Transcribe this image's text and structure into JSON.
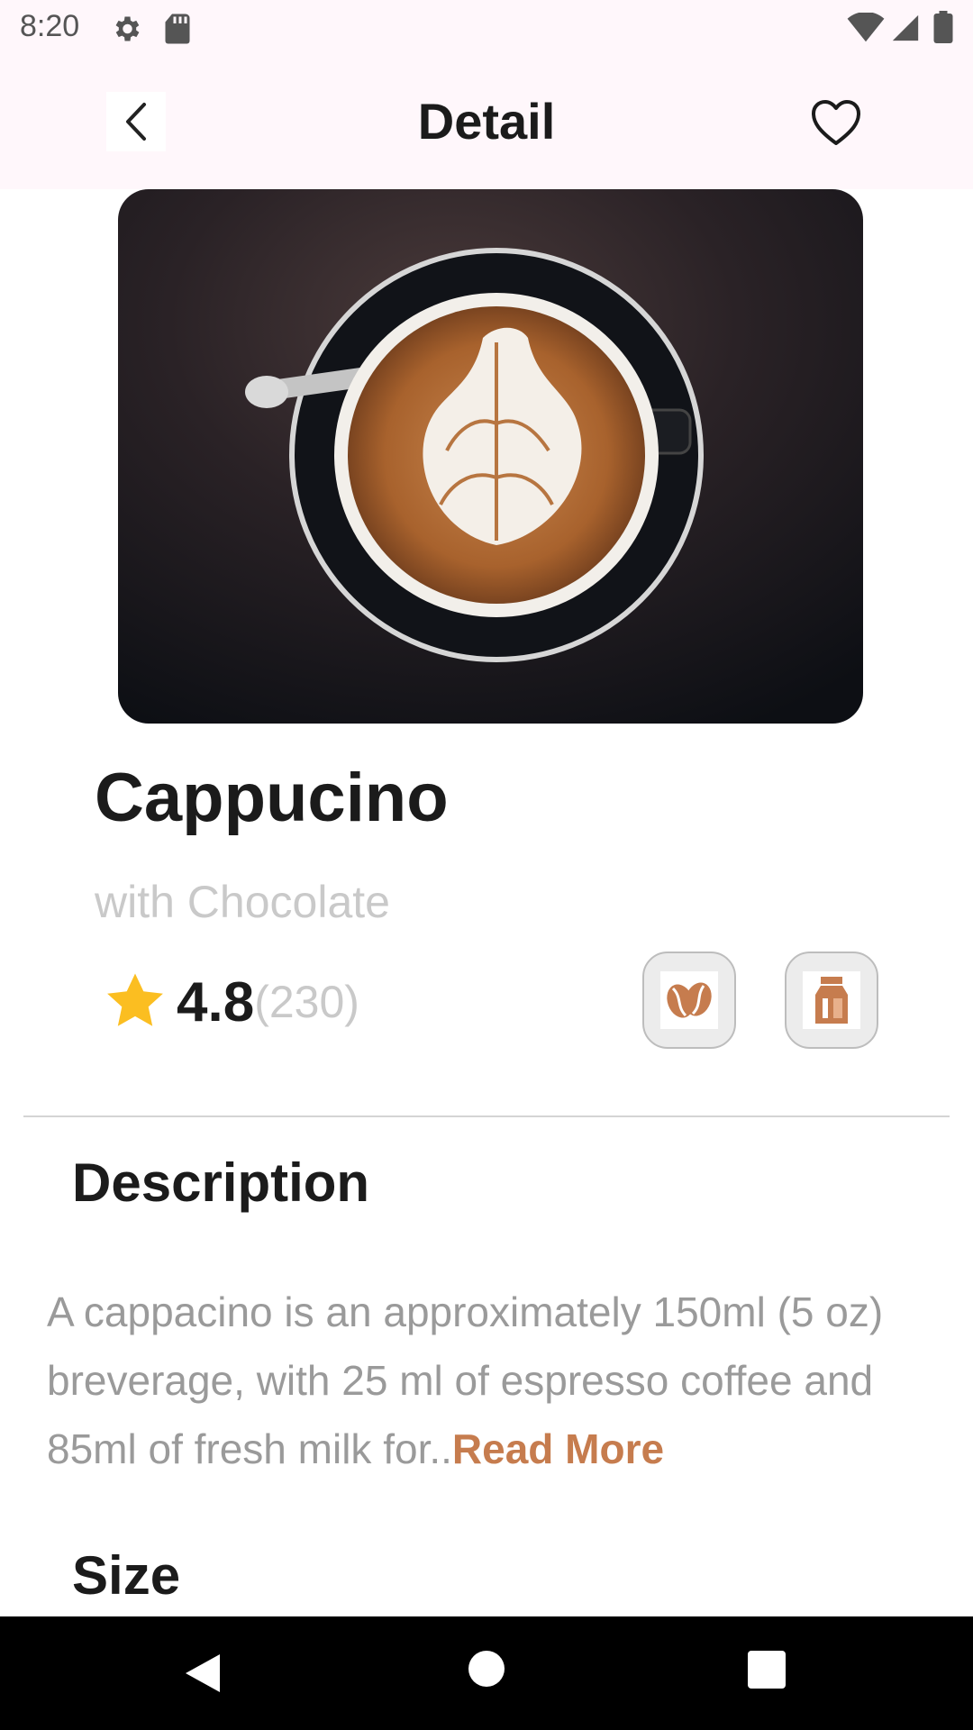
{
  "status_bar": {
    "time": "8:20",
    "icons": [
      "gear-icon",
      "sd-card-icon",
      "wifi-icon",
      "signal-icon",
      "battery-icon"
    ]
  },
  "app_bar": {
    "title": "Detail",
    "back_icon": "chevron-left-icon",
    "favorite_icon": "heart-outline-icon"
  },
  "product": {
    "image": "cappuccino-latte-art-photo",
    "name": "Cappucino",
    "subtitle": "with Chocolate",
    "rating": "4.8",
    "rating_count": "(230)",
    "features": [
      "coffee-bean-icon",
      "milk-icon"
    ]
  },
  "description": {
    "heading": "Description",
    "text": "A cappacino is an approximately 150ml (5 oz) breverage, with 25 ml of espresso coffee and 85ml of fresh milk for..",
    "read_more": "Read More"
  },
  "size": {
    "heading": "Size"
  },
  "colors": {
    "accent": "#c67c4e",
    "star": "#fbbe21",
    "app_bar_bg": "#fff7fb",
    "muted_text": "#9a9a9a"
  },
  "nav_bar": {
    "icons": [
      "back-triangle-icon",
      "home-circle-icon",
      "recents-square-icon"
    ]
  }
}
